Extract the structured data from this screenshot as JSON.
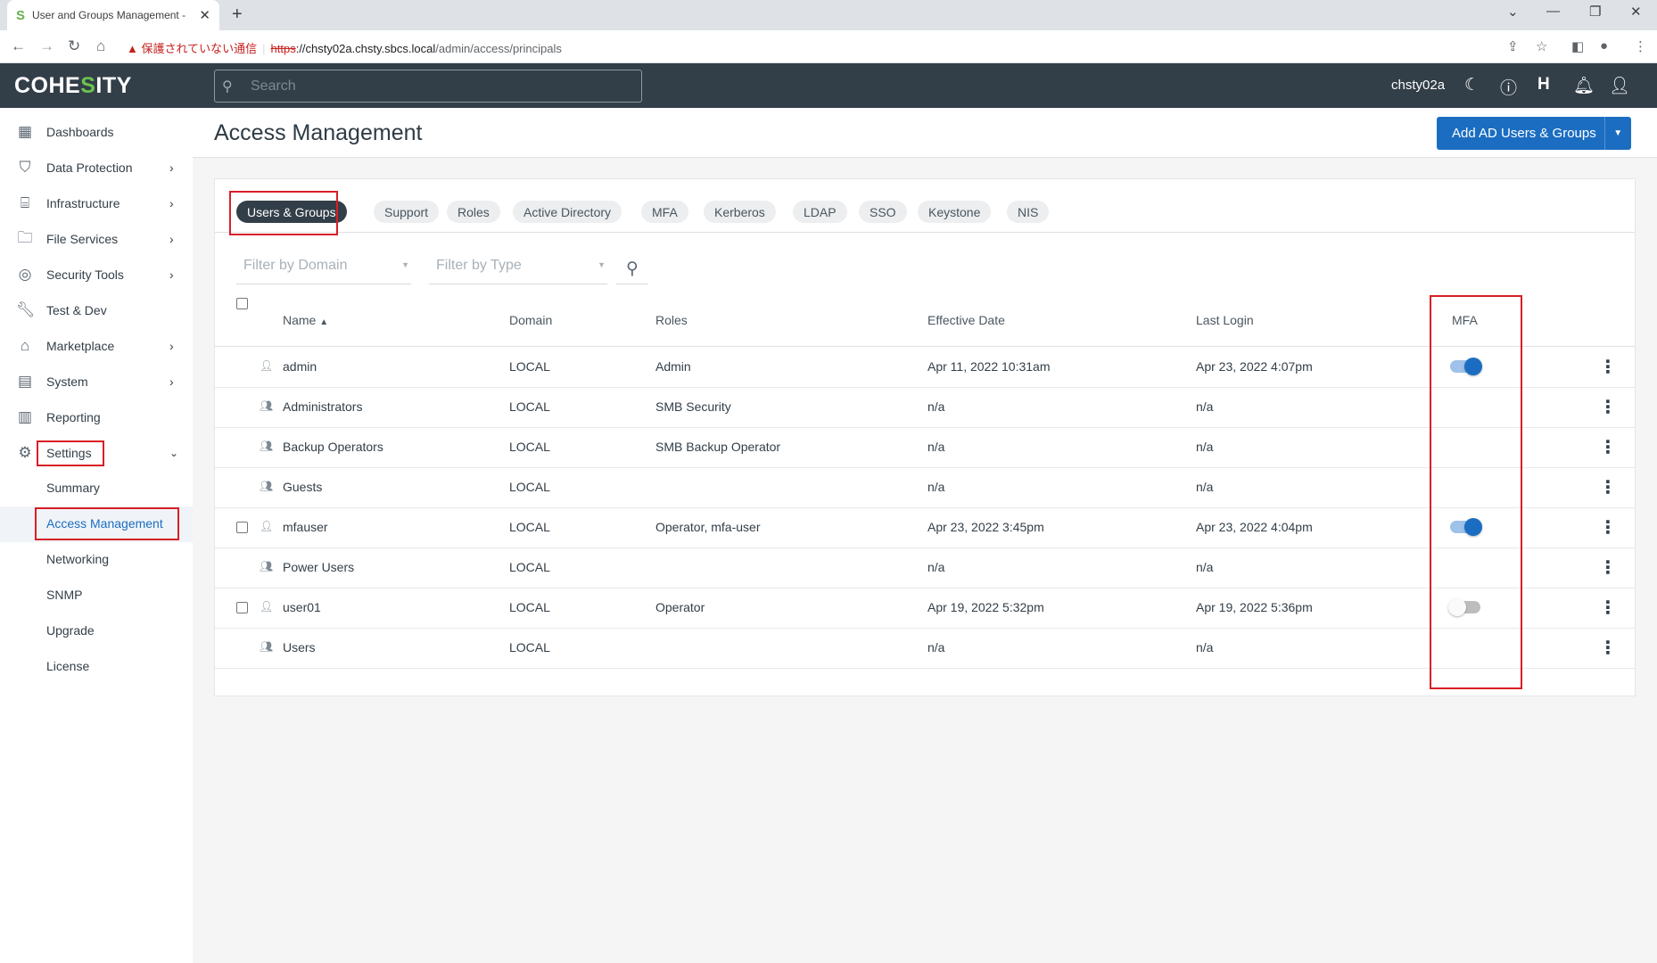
{
  "browser": {
    "tab_title": "User and Groups Management - ",
    "tab_close": "✕",
    "new_tab": "+",
    "security_warning": "保護されていない通信",
    "url_scheme": "https",
    "url_rest": "://chsty02a.chsty.sbcs.local",
    "url_path": "/admin/access/principals"
  },
  "header": {
    "logo_pre": "COHE",
    "logo_s": "S",
    "logo_post": "ITY",
    "search_placeholder": "Search",
    "username": "chsty02a"
  },
  "sidebar": {
    "items": [
      {
        "label": "Dashboards",
        "icon": "dashboard-icon"
      },
      {
        "label": "Data Protection",
        "icon": "shield-icon"
      },
      {
        "label": "Infrastructure",
        "icon": "infrastructure-icon"
      },
      {
        "label": "File Services",
        "icon": "folder-icon"
      },
      {
        "label": "Security Tools",
        "icon": "fingerprint-icon"
      },
      {
        "label": "Test & Dev",
        "icon": "wrench-icon"
      },
      {
        "label": "Marketplace",
        "icon": "store-icon"
      },
      {
        "label": "System",
        "icon": "system-icon"
      },
      {
        "label": "Reporting",
        "icon": "chart-icon"
      },
      {
        "label": "Settings",
        "icon": "gear-icon"
      }
    ],
    "settings_sub": [
      "Summary",
      "Access Management",
      "Networking",
      "SNMP",
      "Upgrade",
      "License"
    ]
  },
  "page": {
    "title": "Access Management",
    "add_button": "Add AD Users & Groups"
  },
  "tabs": [
    "Users & Groups",
    "Support",
    "Roles",
    "Active Directory",
    "MFA",
    "Kerberos",
    "LDAP",
    "SSO",
    "Keystone",
    "NIS"
  ],
  "filters": {
    "domain_placeholder": "Filter by Domain",
    "type_placeholder": "Filter by Type"
  },
  "table": {
    "headers": {
      "name": "Name",
      "domain": "Domain",
      "roles": "Roles",
      "effective": "Effective Date",
      "last_login": "Last Login",
      "mfa": "MFA"
    },
    "sort_indicator": "▲",
    "rows": [
      {
        "name": "admin",
        "type": "user",
        "domain": "LOCAL",
        "roles": "Admin",
        "effective": "Apr 11, 2022 10:31am",
        "last_login": "Apr 23, 2022 4:07pm",
        "mfa": "on"
      },
      {
        "name": "Administrators",
        "type": "group",
        "domain": "LOCAL",
        "roles": "SMB Security",
        "effective": "n/a",
        "last_login": "n/a",
        "mfa": ""
      },
      {
        "name": "Backup Operators",
        "type": "group",
        "domain": "LOCAL",
        "roles": "SMB Backup Operator",
        "effective": "n/a",
        "last_login": "n/a",
        "mfa": ""
      },
      {
        "name": "Guests",
        "type": "group",
        "domain": "LOCAL",
        "roles": "",
        "effective": "n/a",
        "last_login": "n/a",
        "mfa": ""
      },
      {
        "name": "mfauser",
        "type": "user",
        "domain": "LOCAL",
        "roles": "Operator, mfa-user",
        "effective": "Apr 23, 2022 3:45pm",
        "last_login": "Apr 23, 2022 4:04pm",
        "mfa": "on"
      },
      {
        "name": "Power Users",
        "type": "group",
        "domain": "LOCAL",
        "roles": "",
        "effective": "n/a",
        "last_login": "n/a",
        "mfa": ""
      },
      {
        "name": "user01",
        "type": "user",
        "domain": "LOCAL",
        "roles": "Operator",
        "effective": "Apr 19, 2022 5:32pm",
        "last_login": "Apr 19, 2022 5:36pm",
        "mfa": "off"
      },
      {
        "name": "Users",
        "type": "group",
        "domain": "LOCAL",
        "roles": "",
        "effective": "n/a",
        "last_login": "n/a",
        "mfa": ""
      }
    ]
  },
  "colors": {
    "accent": "#1b6dc1",
    "header_bg": "#323e48",
    "highlight_box": "#d81f26",
    "logo_s": "#6bc24e"
  }
}
